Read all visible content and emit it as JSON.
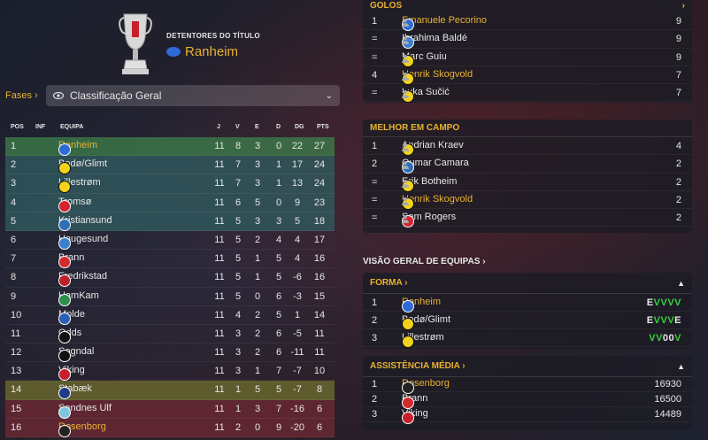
{
  "holders": {
    "label": "DETENTORES DO TÍTULO",
    "team": "Ranheim"
  },
  "phases": {
    "label": "Fases",
    "arrow": "›"
  },
  "dropdown": {
    "selected": "Classificação Geral",
    "icon": "eye-icon"
  },
  "table": {
    "headers": {
      "pos": "POS",
      "inf": "INF",
      "team": "EQUIPA",
      "j": "J",
      "v": "V",
      "e": "E",
      "d": "D",
      "dg": "DG",
      "pts": "PTS"
    },
    "rows": [
      {
        "pos": "1",
        "team": "Ranheim",
        "j": "11",
        "v": "8",
        "e": "3",
        "d": "0",
        "dg": "22",
        "pts": "27"
      },
      {
        "pos": "2",
        "team": "Bodø/Glimt",
        "j": "11",
        "v": "7",
        "e": "3",
        "d": "1",
        "dg": "17",
        "pts": "24"
      },
      {
        "pos": "3",
        "team": "Lillestrøm",
        "j": "11",
        "v": "7",
        "e": "3",
        "d": "1",
        "dg": "13",
        "pts": "24"
      },
      {
        "pos": "4",
        "team": "Tromsø",
        "j": "11",
        "v": "6",
        "e": "5",
        "d": "0",
        "dg": "9",
        "pts": "23"
      },
      {
        "pos": "5",
        "team": "Kristiansund",
        "j": "11",
        "v": "5",
        "e": "3",
        "d": "3",
        "dg": "5",
        "pts": "18"
      },
      {
        "pos": "6",
        "team": "Haugesund",
        "j": "11",
        "v": "5",
        "e": "2",
        "d": "4",
        "dg": "4",
        "pts": "17"
      },
      {
        "pos": "7",
        "team": "Brann",
        "j": "11",
        "v": "5",
        "e": "1",
        "d": "5",
        "dg": "4",
        "pts": "16"
      },
      {
        "pos": "8",
        "team": "Fredrikstad",
        "j": "11",
        "v": "5",
        "e": "1",
        "d": "5",
        "dg": "-6",
        "pts": "16"
      },
      {
        "pos": "9",
        "team": "HamKam",
        "j": "11",
        "v": "5",
        "e": "0",
        "d": "6",
        "dg": "-3",
        "pts": "15"
      },
      {
        "pos": "10",
        "team": "Molde",
        "j": "11",
        "v": "4",
        "e": "2",
        "d": "5",
        "dg": "1",
        "pts": "14"
      },
      {
        "pos": "11",
        "team": "Odds",
        "j": "11",
        "v": "3",
        "e": "2",
        "d": "6",
        "dg": "-5",
        "pts": "11"
      },
      {
        "pos": "12",
        "team": "Sogndal",
        "j": "11",
        "v": "3",
        "e": "2",
        "d": "6",
        "dg": "-11",
        "pts": "11"
      },
      {
        "pos": "13",
        "team": "Viking",
        "j": "11",
        "v": "3",
        "e": "1",
        "d": "7",
        "dg": "-7",
        "pts": "10"
      },
      {
        "pos": "14",
        "team": "Stabæk",
        "j": "11",
        "v": "1",
        "e": "5",
        "d": "5",
        "dg": "-7",
        "pts": "8"
      },
      {
        "pos": "15",
        "team": "Sandnes Ulf",
        "j": "11",
        "v": "1",
        "e": "3",
        "d": "7",
        "dg": "-16",
        "pts": "6"
      },
      {
        "pos": "16",
        "team": "Rosenborg",
        "j": "11",
        "v": "2",
        "e": "0",
        "d": "9",
        "dg": "-20",
        "pts": "6"
      }
    ]
  },
  "goals": {
    "title": "GOLOS",
    "rows": [
      {
        "rank": "1",
        "player": "Emanuele Pecorino",
        "value": "9"
      },
      {
        "rank": "=",
        "player": "Ibrahima Baldé",
        "value": "9"
      },
      {
        "rank": "=",
        "player": "Marc Guiu",
        "value": "9"
      },
      {
        "rank": "4",
        "player": "Henrik Skogvold",
        "value": "7"
      },
      {
        "rank": "=",
        "player": "Luka Sučić",
        "value": "7"
      }
    ]
  },
  "best": {
    "title": "MELHOR EM CAMPO",
    "rows": [
      {
        "rank": "1",
        "player": "Andrian Kraev",
        "value": "4"
      },
      {
        "rank": "2",
        "player": "Oumar Camara",
        "value": "2"
      },
      {
        "rank": "=",
        "player": "Erik Botheim",
        "value": "2"
      },
      {
        "rank": "=",
        "player": "Henrik Skogvold",
        "value": "2"
      },
      {
        "rank": "=",
        "player": "Sam Rogers",
        "value": "2"
      }
    ]
  },
  "overview": {
    "label": "VISÃO GERAL DE EQUIPAS"
  },
  "form": {
    "title": "FORMA",
    "rows": [
      {
        "rank": "1",
        "team": "Ranheim",
        "form": "EVVVV"
      },
      {
        "rank": "2",
        "team": "Bodø/Glimt",
        "form": "EVVVE"
      },
      {
        "rank": "3",
        "team": "Lillestrøm",
        "form": "VV00V"
      }
    ]
  },
  "attendance": {
    "title": "ASSISTÊNCIA MÉDIA",
    "rows": [
      {
        "rank": "1",
        "team": "Rosenborg",
        "value": "16930"
      },
      {
        "rank": "2",
        "team": "Brann",
        "value": "16500"
      },
      {
        "rank": "3",
        "team": "Viking",
        "value": "14489"
      }
    ]
  },
  "colors": {
    "accent": "#e8b130",
    "champion": "#3c7a4a",
    "europe": "#2f5a5e",
    "relegation_playoff": "#6b6a2e",
    "relegation": "#6b2833",
    "win": "#3ad13a"
  }
}
